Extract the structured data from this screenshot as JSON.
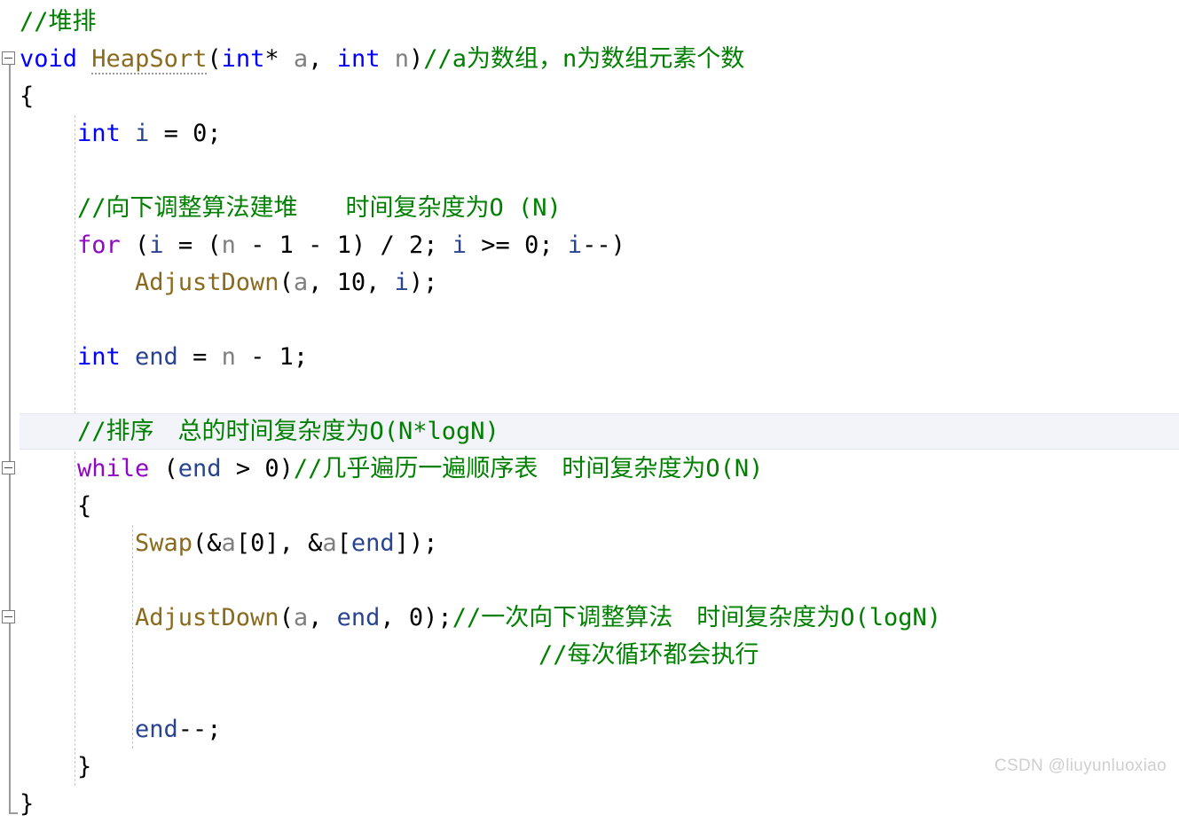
{
  "editor": {
    "language": "C",
    "font_size_px": 27,
    "line_height_px": 42,
    "background": "#ffffff",
    "colors": {
      "keyword": "#0000ff",
      "control_keyword": "#8f08c4",
      "function": "#8a6a1d",
      "parameter": "#808080",
      "variable": "#28438f",
      "comment": "#008000",
      "plain": "#000000",
      "current_line_background": "#f3f3fa",
      "current_line_border": "#e6e6f2",
      "indent_guide": "#c8c8c8",
      "fold_gutter": "#9a9a9a",
      "watermark": "#cfcfcf"
    },
    "current_line_index": 8
  },
  "lines": [
    {
      "indent": 0,
      "tokens": [
        {
          "t": "//堆排",
          "c": "cmt"
        }
      ]
    },
    {
      "indent": 0,
      "fold": "open",
      "tokens": [
        {
          "t": "void",
          "c": "kw"
        },
        {
          "t": " ",
          "c": "punc"
        },
        {
          "t": "HeapSort",
          "c": "fn squiggle"
        },
        {
          "t": "(",
          "c": "punc"
        },
        {
          "t": "int",
          "c": "kw"
        },
        {
          "t": "* ",
          "c": "punc"
        },
        {
          "t": "a",
          "c": "param"
        },
        {
          "t": ", ",
          "c": "punc"
        },
        {
          "t": "int",
          "c": "kw"
        },
        {
          "t": " ",
          "c": "punc"
        },
        {
          "t": "n",
          "c": "param"
        },
        {
          "t": ")",
          "c": "punc"
        },
        {
          "t": "//a为数组，n为数组元素个数",
          "c": "cmt"
        }
      ]
    },
    {
      "indent": 0,
      "tokens": [
        {
          "t": "{",
          "c": "punc"
        }
      ]
    },
    {
      "indent": 1,
      "tokens": [
        {
          "t": "int",
          "c": "kw"
        },
        {
          "t": " ",
          "c": "punc"
        },
        {
          "t": "i",
          "c": "var"
        },
        {
          "t": " = ",
          "c": "punc"
        },
        {
          "t": "0",
          "c": "num"
        },
        {
          "t": ";",
          "c": "punc"
        }
      ]
    },
    {
      "indent": 1,
      "tokens": []
    },
    {
      "indent": 1,
      "tokens": [
        {
          "t": "//向下调整算法建堆　　时间复杂度为O (N)",
          "c": "cmt"
        }
      ]
    },
    {
      "indent": 1,
      "tokens": [
        {
          "t": "for",
          "c": "ctl"
        },
        {
          "t": " (",
          "c": "punc"
        },
        {
          "t": "i",
          "c": "var"
        },
        {
          "t": " = (",
          "c": "punc"
        },
        {
          "t": "n",
          "c": "param"
        },
        {
          "t": " - ",
          "c": "punc"
        },
        {
          "t": "1",
          "c": "num"
        },
        {
          "t": " - ",
          "c": "punc"
        },
        {
          "t": "1",
          "c": "num"
        },
        {
          "t": ") / ",
          "c": "punc"
        },
        {
          "t": "2",
          "c": "num"
        },
        {
          "t": "; ",
          "c": "punc"
        },
        {
          "t": "i",
          "c": "var"
        },
        {
          "t": " >= ",
          "c": "punc"
        },
        {
          "t": "0",
          "c": "num"
        },
        {
          "t": "; ",
          "c": "punc"
        },
        {
          "t": "i",
          "c": "var"
        },
        {
          "t": "--)",
          "c": "punc"
        }
      ]
    },
    {
      "indent": 2,
      "tokens": [
        {
          "t": "AdjustDown",
          "c": "fn"
        },
        {
          "t": "(",
          "c": "punc"
        },
        {
          "t": "a",
          "c": "param"
        },
        {
          "t": ", ",
          "c": "punc"
        },
        {
          "t": "10",
          "c": "num"
        },
        {
          "t": ", ",
          "c": "punc"
        },
        {
          "t": "i",
          "c": "var"
        },
        {
          "t": ");",
          "c": "punc"
        }
      ]
    },
    {
      "indent": 1,
      "tokens": []
    },
    {
      "indent": 1,
      "tokens": [
        {
          "t": "int",
          "c": "kw"
        },
        {
          "t": " ",
          "c": "punc"
        },
        {
          "t": "end",
          "c": "var"
        },
        {
          "t": " = ",
          "c": "punc"
        },
        {
          "t": "n",
          "c": "param"
        },
        {
          "t": " - ",
          "c": "punc"
        },
        {
          "t": "1",
          "c": "num"
        },
        {
          "t": ";",
          "c": "punc"
        }
      ]
    },
    {
      "indent": 1,
      "tokens": []
    },
    {
      "indent": 1,
      "highlight": true,
      "tokens": [
        {
          "t": "//排序　总的时间复杂度为O(N*logN)",
          "c": "cmt"
        }
      ]
    },
    {
      "indent": 1,
      "fold": "open",
      "tokens": [
        {
          "t": "while",
          "c": "ctl"
        },
        {
          "t": " (",
          "c": "punc"
        },
        {
          "t": "end",
          "c": "var"
        },
        {
          "t": " > ",
          "c": "punc"
        },
        {
          "t": "0",
          "c": "num"
        },
        {
          "t": ")",
          "c": "punc"
        },
        {
          "t": "//几乎遍历一遍顺序表　时间复杂度为O(N)",
          "c": "cmt"
        }
      ]
    },
    {
      "indent": 1,
      "tokens": [
        {
          "t": "{",
          "c": "punc"
        }
      ]
    },
    {
      "indent": 2,
      "tokens": [
        {
          "t": "Swap",
          "c": "fn"
        },
        {
          "t": "(&",
          "c": "punc"
        },
        {
          "t": "a",
          "c": "param"
        },
        {
          "t": "[",
          "c": "punc"
        },
        {
          "t": "0",
          "c": "num"
        },
        {
          "t": "], &",
          "c": "punc"
        },
        {
          "t": "a",
          "c": "param"
        },
        {
          "t": "[",
          "c": "punc"
        },
        {
          "t": "end",
          "c": "var"
        },
        {
          "t": "]);",
          "c": "punc"
        }
      ]
    },
    {
      "indent": 2,
      "tokens": []
    },
    {
      "indent": 2,
      "fold": "open",
      "tokens": [
        {
          "t": "AdjustDown",
          "c": "fn"
        },
        {
          "t": "(",
          "c": "punc"
        },
        {
          "t": "a",
          "c": "param"
        },
        {
          "t": ", ",
          "c": "punc"
        },
        {
          "t": "end",
          "c": "var"
        },
        {
          "t": ", ",
          "c": "punc"
        },
        {
          "t": "0",
          "c": "num"
        },
        {
          "t": ");",
          "c": "punc"
        },
        {
          "t": "//一次向下调整算法　时间复杂度为O(logN)",
          "c": "cmt"
        }
      ]
    },
    {
      "indent": 9,
      "tokens": [
        {
          "t": "//每次循环都会执行",
          "c": "cmt"
        }
      ]
    },
    {
      "indent": 2,
      "tokens": []
    },
    {
      "indent": 2,
      "tokens": [
        {
          "t": "end",
          "c": "var"
        },
        {
          "t": "--;",
          "c": "punc"
        }
      ]
    },
    {
      "indent": 1,
      "tokens": [
        {
          "t": "}",
          "c": "punc"
        }
      ]
    },
    {
      "indent": 0,
      "tokens": [
        {
          "t": "}",
          "c": "punc"
        }
      ]
    }
  ],
  "watermark": {
    "text": "CSDN @liuyunluoxiao"
  }
}
